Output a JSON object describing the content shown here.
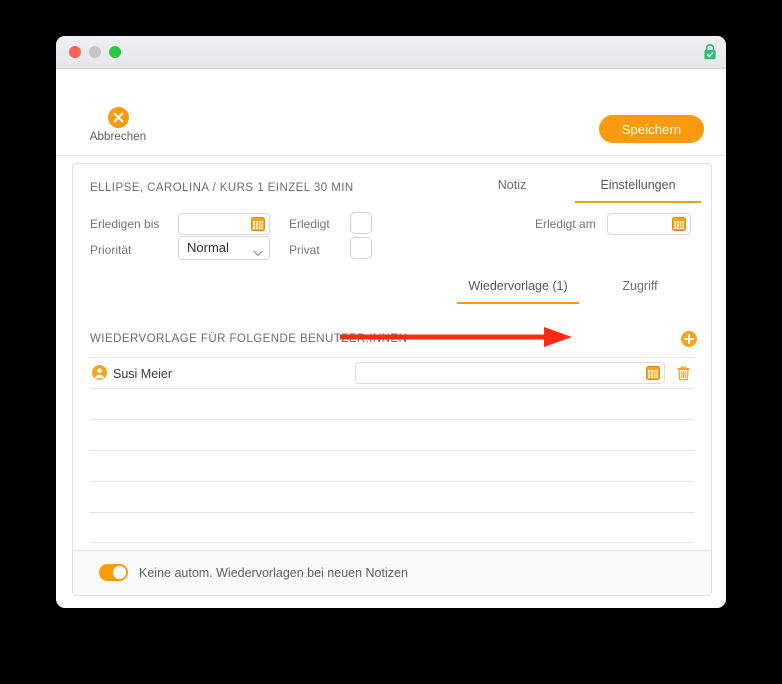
{
  "window": {
    "traffic_lights": [
      "close",
      "minimize",
      "zoom"
    ],
    "lock_icon": "green-padlock-icon",
    "accent_color": "#f99b0c",
    "lock_color": "#2ebd77"
  },
  "toolbar": {
    "cancel_label": "Abbrechen",
    "cancel_icon": "cancel-circle-x-icon",
    "save_label": "Speichern"
  },
  "content": {
    "record_title": "ELLIPSE, CAROLINA / KURS 1 EINZEL 30 MIN",
    "top_tabs": [
      {
        "label": "Notiz",
        "active": false
      },
      {
        "label": "Einstellungen",
        "active": true
      }
    ],
    "form": {
      "due_date_label": "Erledigen bis",
      "due_date_value": "",
      "done_checkbox_label": "Erledigt",
      "done_checkbox_checked": false,
      "done_at_label": "Erledigt am",
      "done_at_value": "",
      "priority_label": "Priorität",
      "priority_value": "Normal",
      "priority_options": [
        "Normal"
      ],
      "private_checkbox_label": "Privat",
      "private_checkbox_checked": false,
      "calendar_icon": "calendar-icon",
      "chevron_icon": "chevron-down-icon"
    },
    "sub_tabs": [
      {
        "label": "Wiedervorlage (1)",
        "active": true
      },
      {
        "label": "Zugriff",
        "active": false
      }
    ],
    "section": {
      "title": "WIEDERVORLAGE FÜR FOLGENDE BENUTZER:INNEN",
      "add_icon": "add-circle-plus-icon"
    },
    "table": {
      "rows": [
        {
          "user_icon": "user-avatar-icon",
          "user_name": "Susi Meier",
          "date_value": "",
          "calendar_icon": "calendar-icon",
          "delete_icon": "trash-icon",
          "filled": true
        },
        {
          "user_name": "",
          "date_value": "",
          "filled": false
        },
        {
          "user_name": "",
          "date_value": "",
          "filled": false
        },
        {
          "user_name": "",
          "date_value": "",
          "filled": false
        },
        {
          "user_name": "",
          "date_value": "",
          "filled": false
        },
        {
          "user_name": "",
          "date_value": "",
          "filled": false
        }
      ]
    },
    "footer": {
      "toggle_on": true,
      "toggle_label": "Keine autom. Wiedervorlagen bei neuen Notizen"
    }
  },
  "annotation": {
    "arrow_color": "#fc2b12",
    "arrow_direction": "right",
    "points_at": "row-date-field"
  }
}
